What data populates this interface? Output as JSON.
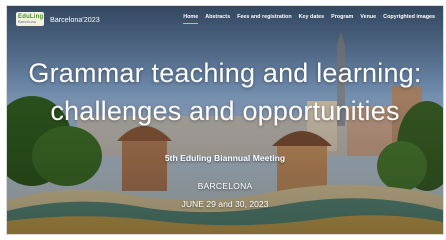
{
  "header": {
    "logo_text": "EduLing",
    "logo_sub": "Barcelona",
    "brand": "Barcelona'2023"
  },
  "nav": {
    "items": [
      {
        "label": "Home",
        "active": true
      },
      {
        "label": "Abstracts"
      },
      {
        "label": "Fees and registration"
      },
      {
        "label": "Key dates"
      },
      {
        "label": "Program"
      },
      {
        "label": "Venue"
      },
      {
        "label": "Copyrighted images"
      }
    ]
  },
  "hero": {
    "title_line1": "Grammar teaching and learning:",
    "title_line2": "challenges and opportunities",
    "meeting": "5th Eduling Biannual Meeting",
    "city": "BARCELONA",
    "dates": "JUNE 29 and 30, 2023"
  },
  "colors": {
    "accent": "#f2b33d",
    "sky": "#7a9ec6"
  }
}
